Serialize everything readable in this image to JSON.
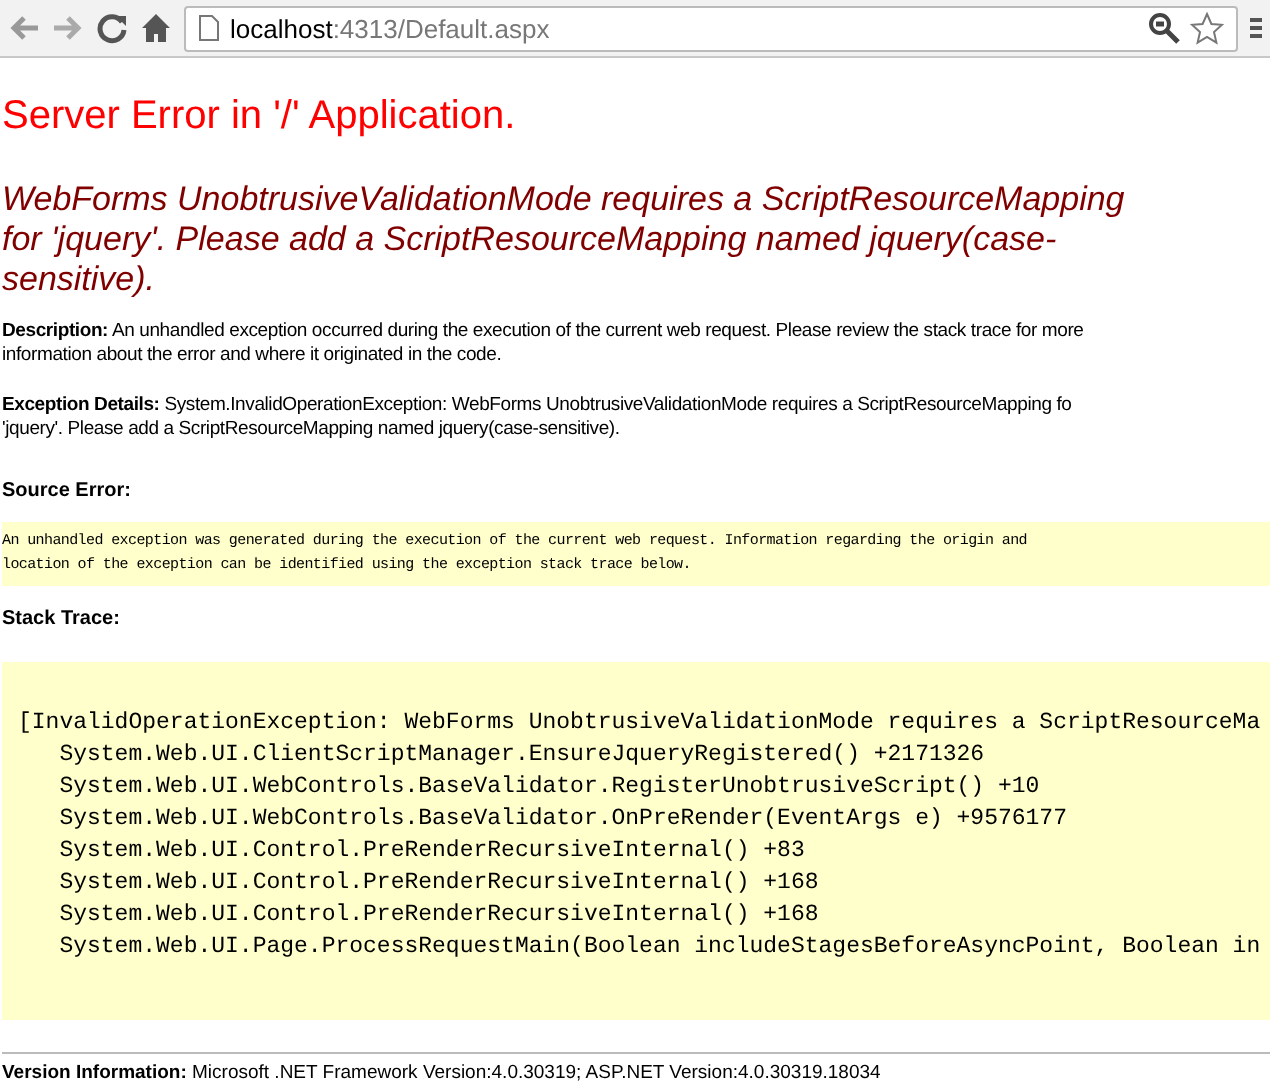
{
  "browser": {
    "host": "localhost",
    "path": ":4313/Default.aspx"
  },
  "title": "Server Error in '/' Application.",
  "message_lines": [
    "WebForms UnobtrusiveValidationMode requires a ScriptResourceMapping",
    "for 'jquery'. Please add a ScriptResourceMapping named jquery(case-",
    "sensitive)."
  ],
  "description": {
    "label": "Description:",
    "lines": [
      "An unhandled exception occurred during the execution of the current web request. Please review the stack trace for more",
      "information about the error and where it originated in the code."
    ]
  },
  "exception_details": {
    "label": "Exception Details:",
    "lines": [
      "System.InvalidOperationException: WebForms UnobtrusiveValidationMode requires a ScriptResourceMapping fo",
      "'jquery'. Please add a ScriptResourceMapping named jquery(case-sensitive)."
    ]
  },
  "source_error": {
    "label": "Source Error:",
    "lines": [
      "An unhandled exception was generated during the execution of the current web request. Information regarding the origin and",
      "location of the exception can be identified using the exception stack trace below."
    ]
  },
  "stack_trace": {
    "label": "Stack Trace:",
    "lines": [
      "[InvalidOperationException: WebForms UnobtrusiveValidationMode requires a ScriptResourceMa",
      "   System.Web.UI.ClientScriptManager.EnsureJqueryRegistered() +2171326",
      "   System.Web.UI.WebControls.BaseValidator.RegisterUnobtrusiveScript() +10",
      "   System.Web.UI.WebControls.BaseValidator.OnPreRender(EventArgs e) +9576177",
      "   System.Web.UI.Control.PreRenderRecursiveInternal() +83",
      "   System.Web.UI.Control.PreRenderRecursiveInternal() +168",
      "   System.Web.UI.Control.PreRenderRecursiveInternal() +168",
      "   System.Web.UI.Page.ProcessRequestMain(Boolean includeStagesBeforeAsyncPoint, Boolean in"
    ]
  },
  "version": {
    "label": "Version Information:",
    "text": "Microsoft .NET Framework Version:4.0.30319; ASP.NET Version:4.0.30319.18034"
  }
}
